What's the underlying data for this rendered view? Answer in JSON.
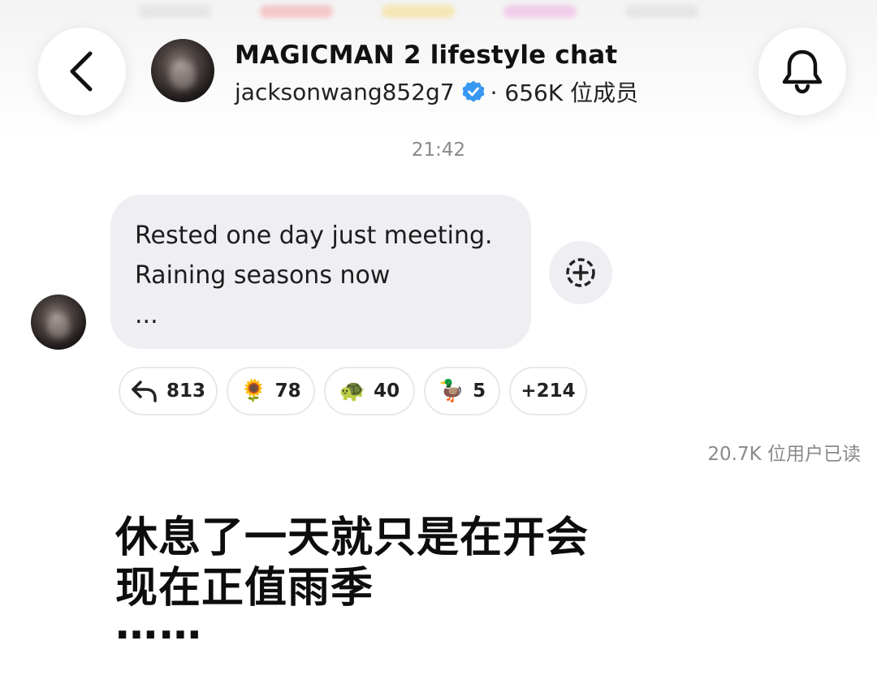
{
  "header": {
    "title": "MAGICMAN 2 lifestyle chat",
    "username": "jacksonwang852g7",
    "member_count": "· 656K 位成员",
    "back_icon": "chevron-left-icon",
    "bell_icon": "bell-icon",
    "verified_icon": "verified-badge-icon",
    "verified_color": "#3897f0"
  },
  "chat": {
    "timestamp": "21:42",
    "message": {
      "lines": [
        "Rested one day just meeting.",
        "Raining seasons now",
        "..."
      ],
      "bubble_color": "#efeff3"
    },
    "add_reaction_icon": "add-reaction-icon",
    "reactions": [
      {
        "icon": "↩",
        "icon_name": "reply-arrow-icon",
        "count": "813"
      },
      {
        "icon": "🌻",
        "icon_name": "sunflower-emoji",
        "count": "78"
      },
      {
        "icon": "🐢",
        "icon_name": "turtle-emoji",
        "count": "40"
      },
      {
        "icon": "🦆",
        "icon_name": "duck-emoji",
        "count": "5"
      },
      {
        "icon": "",
        "icon_name": "",
        "count": "+214"
      }
    ],
    "read_count": "20.7K 位用户已读"
  },
  "caption": {
    "lines": [
      "休息了一天就只是在开会",
      "现在正值雨季",
      "……"
    ]
  }
}
